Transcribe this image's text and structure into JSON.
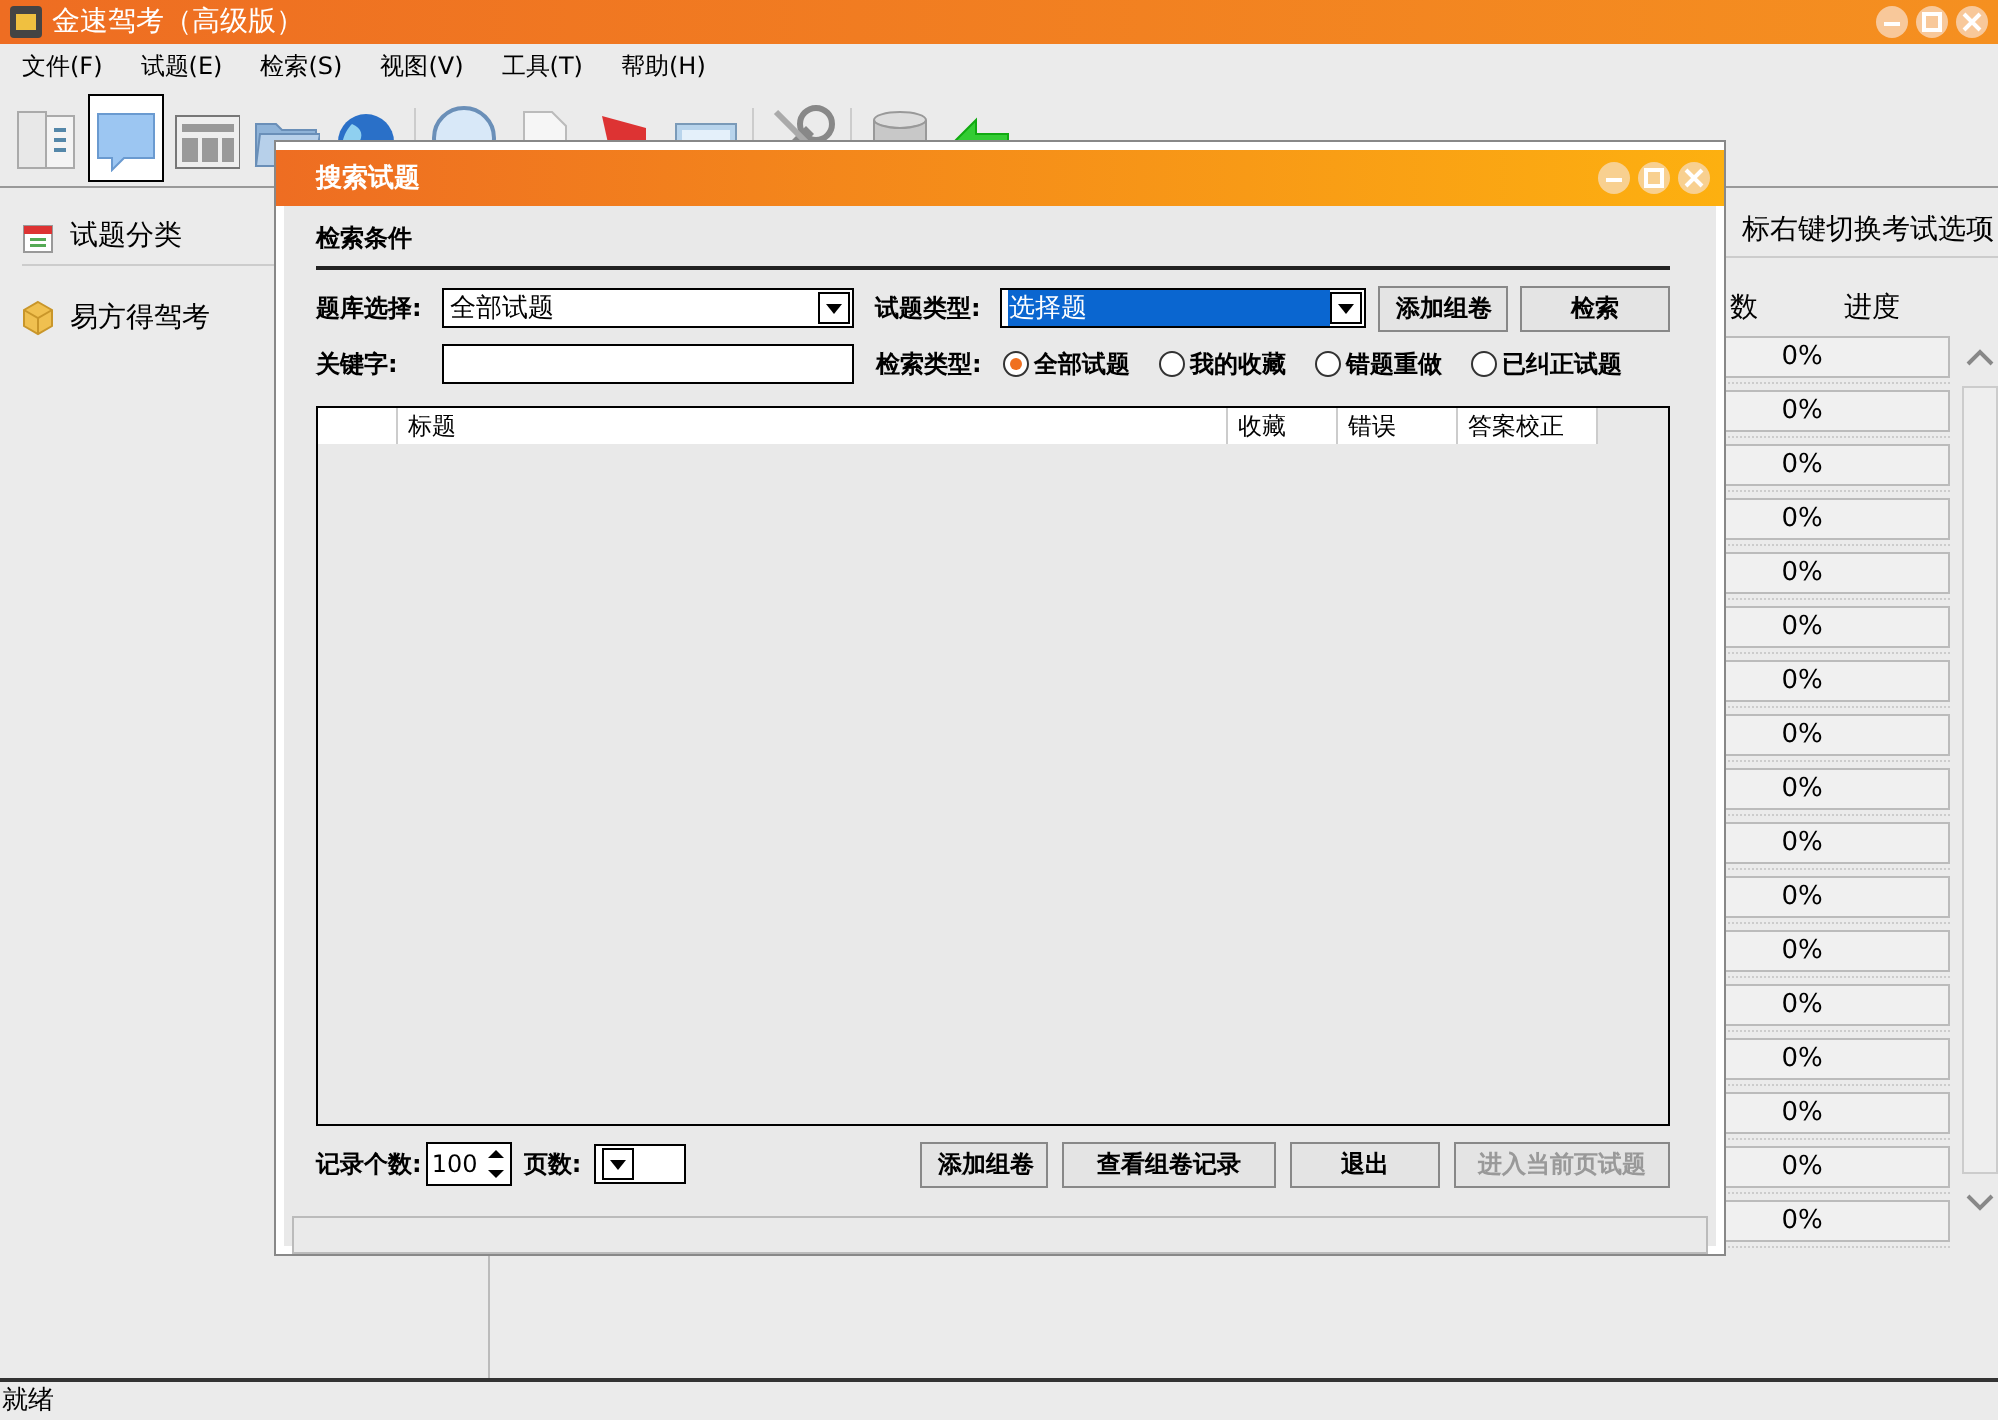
{
  "window": {
    "title": "金速驾考（高级版）"
  },
  "menu": [
    "文件(F)",
    "试题(E)",
    "检索(S)",
    "视图(V)",
    "工具(T)",
    "帮助(H)"
  ],
  "toolbar": [
    {
      "kind": "book",
      "selected": false
    },
    {
      "kind": "bubble",
      "selected": true
    },
    {
      "kind": "news",
      "selected": false
    },
    {
      "kind": "folder",
      "selected": false
    },
    {
      "kind": "globe",
      "selected": false
    },
    {
      "kind": "search",
      "selected": false
    },
    {
      "kind": "page",
      "selected": false
    },
    {
      "kind": "flag",
      "selected": false
    },
    {
      "kind": "monitor",
      "selected": false
    },
    {
      "kind": "tools",
      "selected": false
    },
    {
      "kind": "disk",
      "selected": false
    },
    {
      "kind": "arrow",
      "selected": false
    }
  ],
  "sidebar": {
    "items": [
      {
        "kind": "calendar",
        "label": "试题分类"
      },
      {
        "kind": "cube",
        "label": "易方得驾考"
      }
    ]
  },
  "content": {
    "hint": "标右键切换考试选项",
    "columns": [
      "数",
      "进度"
    ],
    "rows": [
      {
        "progress": "0%"
      },
      {
        "progress": "0%"
      },
      {
        "progress": "0%"
      },
      {
        "progress": "0%"
      },
      {
        "progress": "0%"
      },
      {
        "progress": "0%"
      },
      {
        "progress": "0%"
      },
      {
        "progress": "0%"
      },
      {
        "progress": "0%"
      },
      {
        "progress": "0%"
      },
      {
        "progress": "0%"
      },
      {
        "progress": "0%"
      },
      {
        "progress": "0%"
      },
      {
        "progress": "0%"
      },
      {
        "progress": "0%"
      },
      {
        "progress": "0%"
      },
      {
        "progress": "0%"
      }
    ]
  },
  "dialog": {
    "title": "搜索试题",
    "section": "检索条件",
    "bank": {
      "label": "题库选择:",
      "value": "全部试题"
    },
    "type": {
      "label": "试题类型:",
      "value": "选择题",
      "highlighted": true
    },
    "top_buttons": [
      {
        "label": "添加组卷",
        "disabled": false
      },
      {
        "label": "检索",
        "disabled": false
      }
    ],
    "keyword": {
      "label": "关键字:"
    },
    "search_type": {
      "label": "检索类型:",
      "options": [
        {
          "label": "全部试题",
          "selected": true
        },
        {
          "label": "我的收藏",
          "selected": false
        },
        {
          "label": "错题重做",
          "selected": false
        },
        {
          "label": "已纠正试题",
          "selected": false
        }
      ]
    },
    "table": {
      "columns": [
        "标题",
        "收藏",
        "错误",
        "答案校正"
      ]
    },
    "records": {
      "label": "记录个数:",
      "value": "100"
    },
    "pages": {
      "label": "页数:"
    },
    "buttons": [
      {
        "label": "添加组卷",
        "disabled": false
      },
      {
        "label": "查看组卷记录",
        "disabled": false
      },
      {
        "label": "退出",
        "disabled": false
      },
      {
        "label": "进入当前页试题",
        "disabled": true
      }
    ]
  },
  "status_bar": "就绪"
}
